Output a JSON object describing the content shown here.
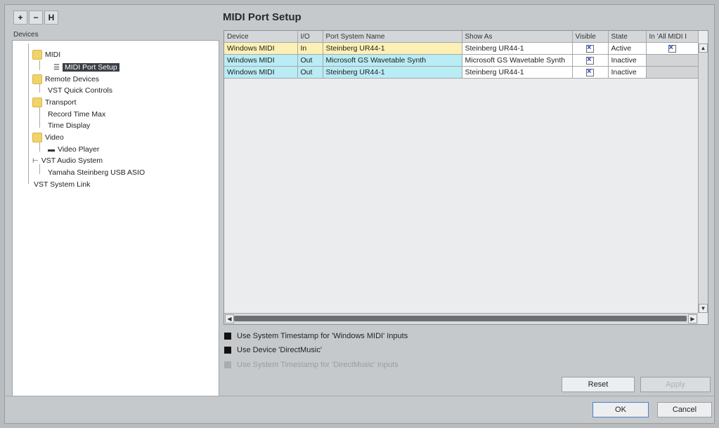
{
  "toolbar": {
    "add": "+",
    "remove": "−",
    "reset_tree": "H"
  },
  "page_title": "MIDI Port Setup",
  "devices_label": "Devices",
  "tree": {
    "midi": "MIDI",
    "midi_port_setup": "MIDI Port Setup",
    "remote_devices": "Remote Devices",
    "vst_quick_controls": "VST Quick Controls",
    "transport": "Transport",
    "record_time_max": "Record Time Max",
    "time_display": "Time Display",
    "video": "Video",
    "video_player": "Video Player",
    "vst_audio_system": "VST Audio System",
    "yamaha_asio": "Yamaha Steinberg USB ASIO",
    "vst_system_link": "VST System Link"
  },
  "table": {
    "headers": [
      "Device",
      "I/O",
      "Port System Name",
      "Show As",
      "Visible",
      "State",
      "In 'All MIDI I"
    ],
    "rows": [
      {
        "device": "Windows MIDI",
        "io": "In",
        "port": "Steinberg UR44-1",
        "show_as": "Steinberg UR44-1",
        "state": "Active"
      },
      {
        "device": "Windows MIDI",
        "io": "Out",
        "port": "Microsoft GS Wavetable Synth",
        "show_as": "Microsoft GS Wavetable Synth",
        "state": "Inactive"
      },
      {
        "device": "Windows MIDI",
        "io": "Out",
        "port": "Steinberg UR44-1",
        "show_as": "Steinberg UR44-1",
        "state": "Inactive"
      }
    ]
  },
  "options": {
    "opt1": "Use System Timestamp for 'Windows MIDI' Inputs",
    "opt2": "Use Device 'DirectMusic'",
    "opt3": "Use System Timestamp for 'DirectMusic' Inputs"
  },
  "buttons": {
    "reset": "Reset",
    "apply": "Apply",
    "ok": "OK",
    "cancel": "Cancel"
  },
  "colors": {
    "row_in": "#fdf0b6",
    "row_out": "#b9ecf4",
    "selection": "#3a3f45"
  }
}
